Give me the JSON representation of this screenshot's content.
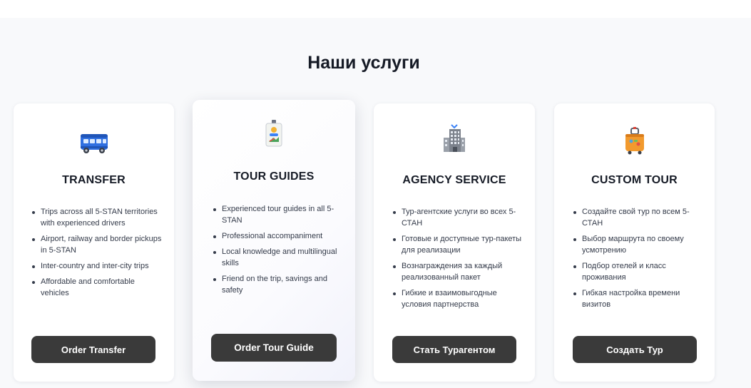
{
  "section": {
    "title": "Наши услуги"
  },
  "colors": {
    "background": "#f8f9fb",
    "card": "#ffffff",
    "button": "#3a3a3a",
    "button_text": "#ffffff",
    "heading": "#161b26"
  },
  "cards": [
    {
      "icon": "bus-icon",
      "title": "TRANSFER",
      "features": [
        "Trips across all 5-STAN territories with experienced drivers",
        "Airport, railway and border pickups in 5-STAN",
        "Inter-country and inter-city trips",
        "Affordable and comfortable vehicles"
      ],
      "button": "Order Transfer"
    },
    {
      "icon": "id-badge-icon",
      "title": "TOUR GUIDES",
      "features": [
        "Experienced tour guides in all 5-STAN",
        "Professional accompaniment",
        "Local knowledge and multilingual skills",
        "Friend on the trip, savings and safety"
      ],
      "button": "Order Tour Guide"
    },
    {
      "icon": "office-building-icon",
      "title": "AGENCY SERVICE",
      "features": [
        "Тур-агентские услуги во всех 5-СТАН",
        "Готовые и доступные тур-пакеты для реализации",
        "Вознаграждения за каждый реализованный пакет",
        "Гибкие и взаимовыгодные условия партнерства"
      ],
      "button": "Стать Турагентом"
    },
    {
      "icon": "luggage-icon",
      "title": "CUSTOM TOUR",
      "features": [
        "Создайте свой тур по всем 5-СТАН",
        "Выбор маршрута по своему усмотрению",
        "Подбор отелей и класс проживания",
        "Гибкая настройка времени визитов"
      ],
      "button": "Создать Тур"
    }
  ]
}
